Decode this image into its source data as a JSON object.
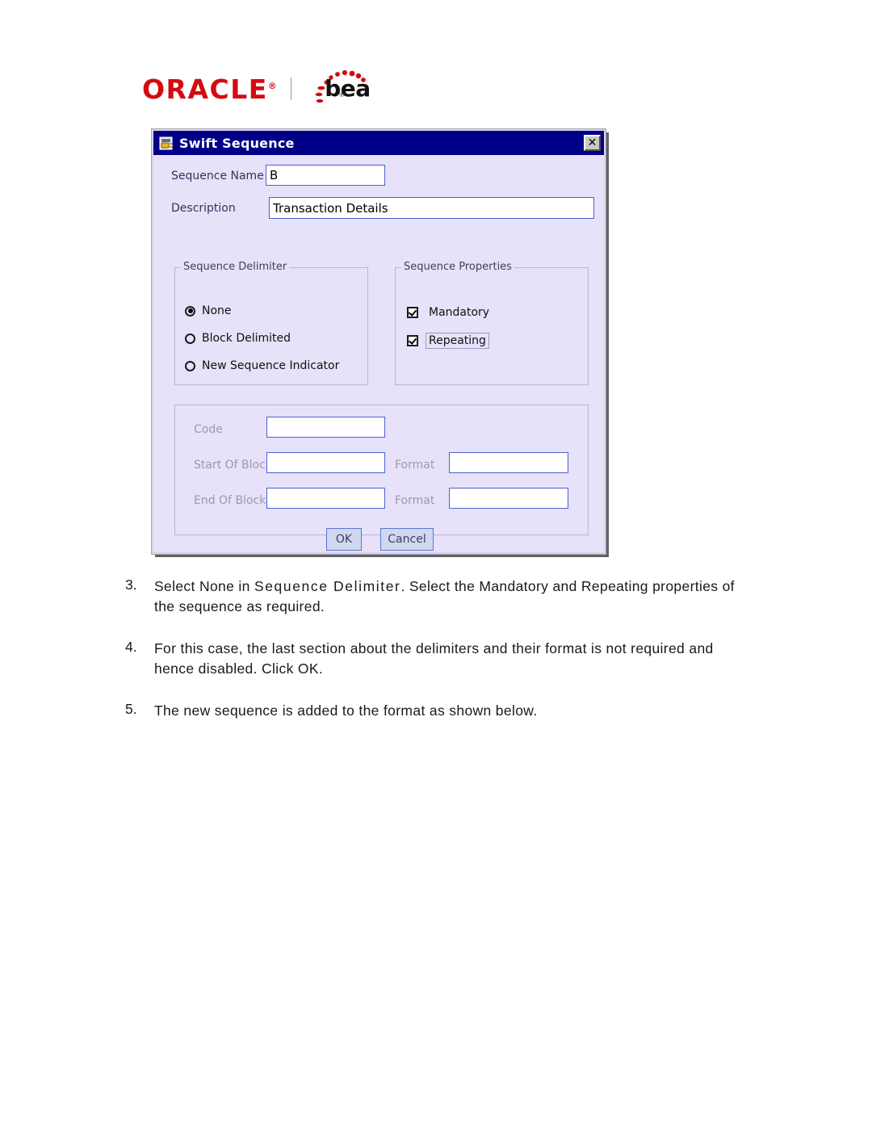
{
  "logo": {
    "oracle_text": "ORACLE",
    "oracle_registered": "®",
    "bea_text": "bea",
    "bea_tm": "®",
    "brand_color": "#d40a11"
  },
  "dialog": {
    "icon": "java-coffee-cup-icon",
    "title": "Swift Sequence",
    "close_label": "✕",
    "titlebar_color": "#000087",
    "background_color": "#e7e1f9",
    "fields": {
      "sequence_name": {
        "label": "Sequence Name",
        "value": "B",
        "placeholder": ""
      },
      "description": {
        "label": "Description",
        "value": "Transaction Details",
        "placeholder": ""
      }
    },
    "sequence_delimiter": {
      "legend": "Sequence Delimiter",
      "selected": "None",
      "options": [
        {
          "label": "None",
          "checked": true
        },
        {
          "label": "Block Delimited",
          "checked": false
        },
        {
          "label": "New Sequence Indicator",
          "checked": false
        }
      ]
    },
    "sequence_properties": {
      "legend": "Sequence Properties",
      "options": [
        {
          "label": "Mandatory",
          "checked": true,
          "focused": false
        },
        {
          "label": "Repeating",
          "checked": true,
          "focused": true
        }
      ]
    },
    "block_section": {
      "disabled": true,
      "rows": [
        {
          "label": "Code",
          "value": "",
          "format_label": "",
          "format_value": ""
        },
        {
          "label": "Start Of Block",
          "value": "",
          "format_label": "Format",
          "format_value": ""
        },
        {
          "label": "End Of Block",
          "value": "",
          "format_label": "Format",
          "format_value": ""
        }
      ]
    },
    "buttons": {
      "ok": "OK",
      "cancel": "Cancel"
    }
  },
  "steps": [
    {
      "number": "3.",
      "text_before": "Select None in ",
      "text_emphasis": "Sequence Delimiter",
      "text_after": ". Select the Mandatory and Repeating properties of the sequence as required."
    },
    {
      "number": "4.",
      "text_before": "For this case, the last section about the delimiters and their format is not required and hence disabled. Click OK.",
      "text_emphasis": "",
      "text_after": ""
    },
    {
      "number": "5.",
      "text_before": "The new sequence is added to the format as shown below.",
      "text_emphasis": "",
      "text_after": ""
    }
  ]
}
